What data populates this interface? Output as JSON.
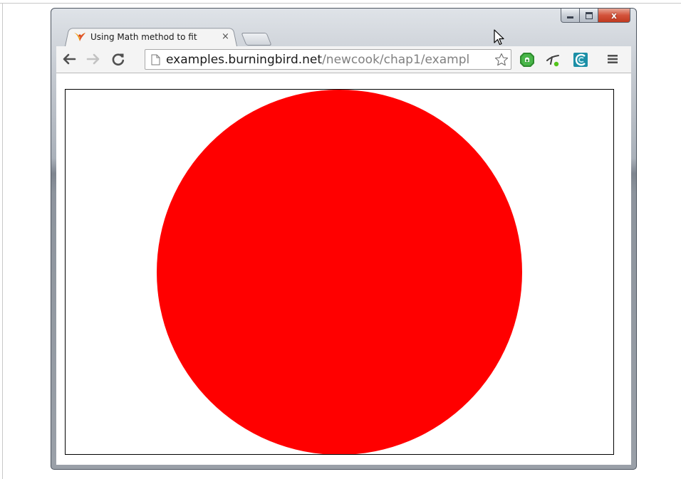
{
  "window": {
    "controls": {
      "minimize_icon": "minimize-icon",
      "maximize_icon": "maximize-icon",
      "close_glyph": "x",
      "close_color": "#c9472c"
    }
  },
  "tabs": [
    {
      "title": "Using Math method to fit",
      "favicon": "burningbird-favicon",
      "close_glyph": "×",
      "active": true
    }
  ],
  "toolbar": {
    "back_icon": "back-arrow-icon",
    "forward_icon": "forward-arrow-icon",
    "reload_icon": "reload-icon",
    "url_host": "examples.burningbird.net",
    "url_path": "/newcook/chap1/exampl",
    "bookmark_icon": "star-icon",
    "extensions": [
      "green-shield-extension-icon",
      "stylus-extension-icon",
      "teal-extension-icon"
    ],
    "menu_icon": "hamburger-menu-icon"
  },
  "content": {
    "shape": "circle",
    "fill_color": "#ff0000",
    "frame_border_color": "#000000"
  }
}
